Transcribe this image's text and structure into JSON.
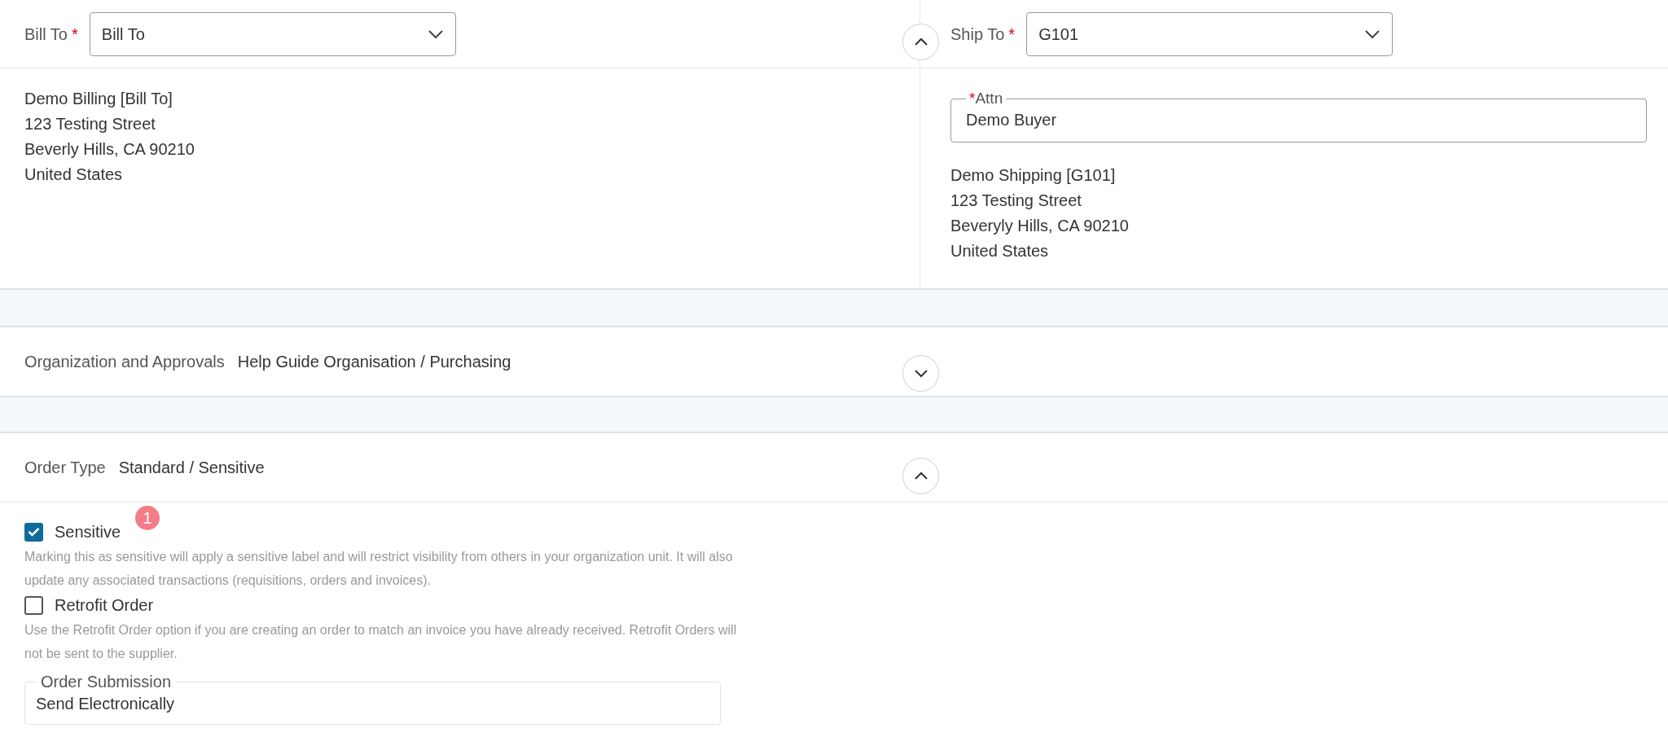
{
  "addresses": {
    "expanded": true,
    "bill_to": {
      "label": "Bill To",
      "required_mark": "*",
      "value": "Bill To",
      "address": [
        "Demo Billing [Bill To]",
        "123 Testing Street",
        "Beverly Hills, CA 90210",
        "United States"
      ]
    },
    "ship_to": {
      "label": "Ship To",
      "required_mark": "*",
      "value": "G101",
      "attn": {
        "label": "Attn",
        "required_mark": "*",
        "value": "Demo Buyer"
      },
      "address": [
        "Demo Shipping [G101]",
        "123 Testing Street",
        "Beveryly Hills, CA 90210",
        "United States"
      ]
    }
  },
  "organization": {
    "label": "Organization and Approvals",
    "value": "Help Guide Organisation / Purchasing",
    "expanded": false
  },
  "order_type": {
    "label": "Order Type",
    "value": "Standard / Sensitive",
    "expanded": true,
    "badge": "1",
    "options": [
      {
        "label": "Sensitive",
        "checked": true,
        "description": "Marking this as sensitive will apply a sensitive label and will restrict visibility from others in your organization unit. It will also update any associated transactions (requisitions, orders and invoices)."
      },
      {
        "label": "Retrofit Order",
        "checked": false,
        "description": "Use the Retrofit Order option if you are creating an order to match an invoice you have already received. Retrofit Orders will not be sent to the supplier."
      }
    ],
    "submission": {
      "label": "Order Submission",
      "value": "Send Electronically"
    }
  }
}
